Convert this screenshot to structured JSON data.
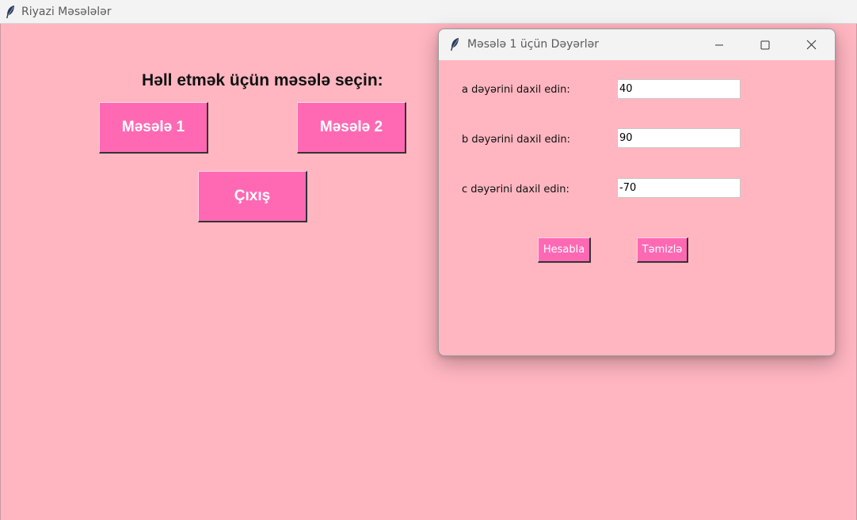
{
  "main_window": {
    "title": "Riyazi Məsələlər",
    "heading": "Həll etmək üçün məsələ seçin:",
    "buttons": {
      "problem1": "Məsələ 1",
      "problem2": "Məsələ 2",
      "exit": "Çıxış"
    }
  },
  "dialog": {
    "title": "Məsələ 1 üçün Dəyərlər",
    "fields": [
      {
        "label": "a dəyərini daxil edin:",
        "value": "40"
      },
      {
        "label": "b dəyərini daxil edin:",
        "value": "90"
      },
      {
        "label": "c dəyərini daxil edin:",
        "value": "-70"
      }
    ],
    "buttons": {
      "calculate": "Hesabla",
      "clear": "Təmizlə"
    }
  },
  "icons": {
    "app": "feather-icon",
    "minimize": "minimize-icon",
    "maximize": "maximize-icon",
    "close": "close-icon"
  },
  "colors": {
    "background": "#ffb6c1",
    "button": "#ff69b4",
    "button_text": "#ffffff"
  }
}
